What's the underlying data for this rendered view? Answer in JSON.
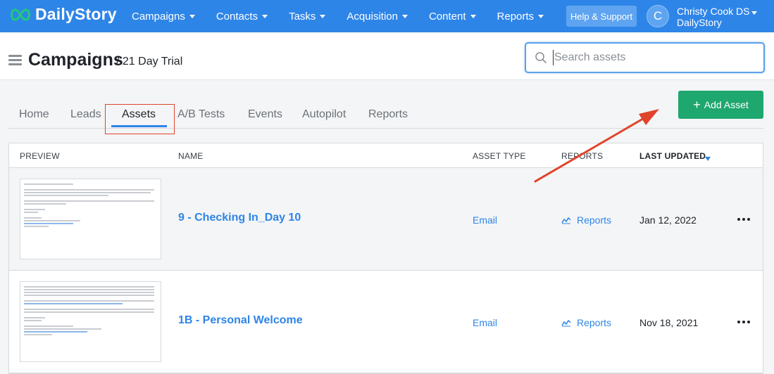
{
  "brand": {
    "name": "DailyStory"
  },
  "nav": {
    "items": [
      {
        "label": "Campaigns"
      },
      {
        "label": "Contacts"
      },
      {
        "label": "Tasks"
      },
      {
        "label": "Acquisition"
      },
      {
        "label": "Content"
      },
      {
        "label": "Reports"
      }
    ],
    "help_label": "Help & Support"
  },
  "user": {
    "initial": "C",
    "name": "Christy Cook DS",
    "org": "DailyStory"
  },
  "page": {
    "title": "Campaigns",
    "subtitle": "/ 21 Day Trial"
  },
  "search": {
    "placeholder": "Search assets",
    "value": ""
  },
  "tabs": [
    {
      "label": "Home"
    },
    {
      "label": "Leads"
    },
    {
      "label": "Assets"
    },
    {
      "label": "A/B Tests"
    },
    {
      "label": "Events"
    },
    {
      "label": "Autopilot"
    },
    {
      "label": "Reports"
    }
  ],
  "active_tab": "Assets",
  "add_asset": {
    "icon": "+",
    "label": "Add Asset"
  },
  "table": {
    "columns": [
      "PREVIEW",
      "NAME",
      "ASSET TYPE",
      "REPORTS",
      "LAST UPDATED"
    ],
    "sorted_by": "LAST UPDATED",
    "rows": [
      {
        "name": "9 - Checking In_Day 10",
        "asset_type": "Email",
        "reports": "Reports",
        "last_updated": "Jan 12, 2022"
      },
      {
        "name": "1B - Personal Welcome",
        "asset_type": "Email",
        "reports": "Reports",
        "last_updated": "Nov 18, 2021"
      }
    ]
  },
  "colors": {
    "topbar": "#2e85e8",
    "accent": "#2e85e8",
    "add_button": "#1ea76f",
    "annotation": "#e0442a"
  },
  "icons": [
    "logo-icon",
    "caret-down-icon",
    "hamburger-icon",
    "search-icon",
    "plus-icon",
    "sort-desc-icon",
    "chart-icon",
    "more-icon",
    "annotation-arrow"
  ]
}
